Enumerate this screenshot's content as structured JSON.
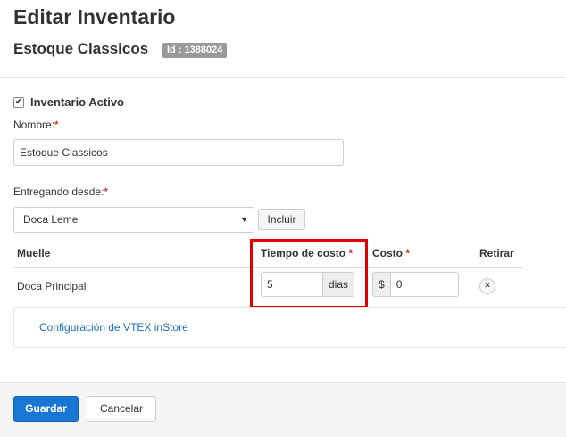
{
  "header": {
    "title": "Editar Inventario",
    "subtitle": "Estoque Classicos",
    "id_badge": "Id : 1388024"
  },
  "form": {
    "active_checkbox": {
      "label": "Inventario Activo",
      "checked": true
    },
    "name": {
      "label": "Nombre:",
      "required_mark": "*",
      "value": "Estoque Classicos"
    },
    "delivering_from": {
      "label": "Entregando desde:",
      "required_mark": "*",
      "selected": "Doca Leme",
      "include_button": "Incluir"
    }
  },
  "table": {
    "headers": {
      "dock": "Muelle",
      "time_cost": "Tiempo de costo",
      "cost": "Costo",
      "remove": "Retirar"
    },
    "required_mark": "*",
    "rows": [
      {
        "dock": "Doca Principal",
        "time_value": "5",
        "time_unit": "dias",
        "currency": "$",
        "cost_value": "0",
        "remove_symbol": "×"
      }
    ]
  },
  "instore_link": "Configuración de VTEX inStore",
  "footer": {
    "save_label": "Guardar",
    "cancel_label": "Cancelar"
  },
  "colors": {
    "primary": "#1877d4",
    "link": "#1a6fb5",
    "required": "#cc0000",
    "highlight": "#e00000",
    "badge": "#999999"
  }
}
